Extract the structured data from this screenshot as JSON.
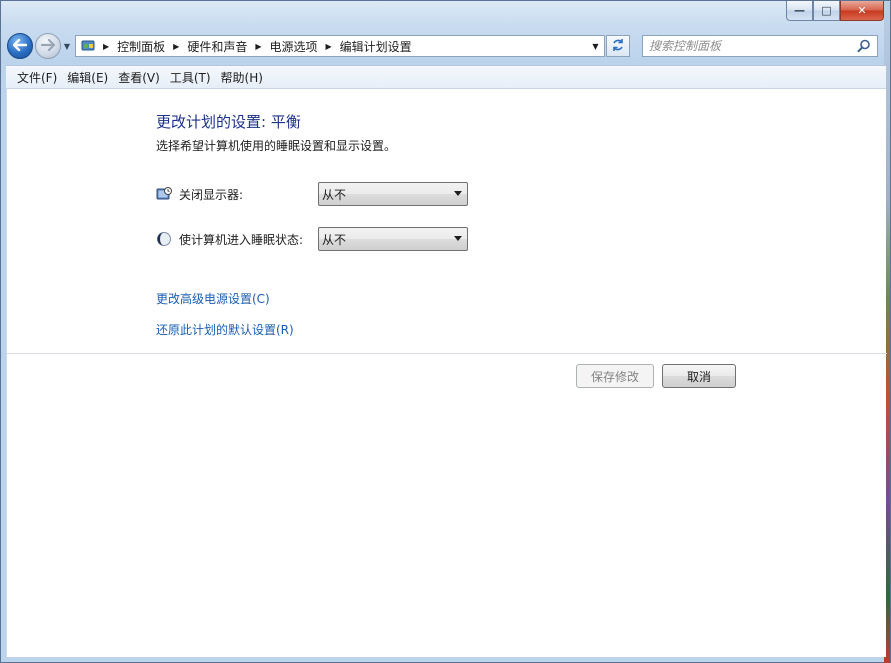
{
  "window": {
    "caption": {
      "minimize": "—",
      "maximize": "□",
      "close": "✕"
    }
  },
  "nav": {
    "breadcrumbs": [
      "控制面板",
      "硬件和声音",
      "电源选项",
      "编辑计划设置"
    ],
    "search_placeholder": "搜索控制面板"
  },
  "menubar": {
    "items": [
      "文件(F)",
      "编辑(E)",
      "查看(V)",
      "工具(T)",
      "帮助(H)"
    ]
  },
  "main": {
    "title": "更改计划的设置: 平衡",
    "subtitle": "选择希望计算机使用的睡眠设置和显示设置。",
    "settings": [
      {
        "label": "关闭显示器:",
        "value": "从不",
        "icon": "monitor-clock-icon"
      },
      {
        "label": "使计算机进入睡眠状态:",
        "value": "从不",
        "icon": "moon-sleep-icon"
      }
    ],
    "links": {
      "advanced": "更改高级电源设置(C)",
      "restore": "还原此计划的默认设置(R)"
    },
    "buttons": {
      "save": "保存修改",
      "cancel": "取消"
    }
  },
  "colors": {
    "title_blue": "#1e3287",
    "link_blue": "#1a5fb4",
    "close_red": "#c7381e"
  }
}
